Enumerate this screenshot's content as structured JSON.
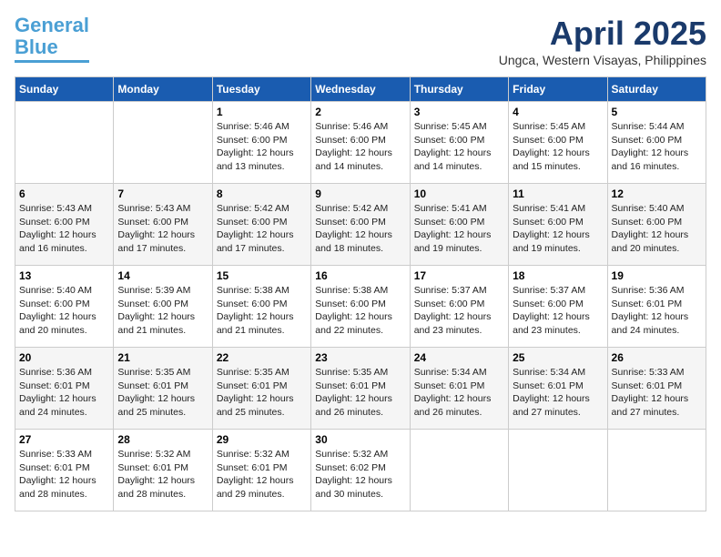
{
  "logo": {
    "line1": "General",
    "line2": "Blue"
  },
  "title": "April 2025",
  "location": "Ungca, Western Visayas, Philippines",
  "weekdays": [
    "Sunday",
    "Monday",
    "Tuesday",
    "Wednesday",
    "Thursday",
    "Friday",
    "Saturday"
  ],
  "weeks": [
    [
      {
        "day": "",
        "info": ""
      },
      {
        "day": "",
        "info": ""
      },
      {
        "day": "1",
        "info": "Sunrise: 5:46 AM\nSunset: 6:00 PM\nDaylight: 12 hours and 13 minutes."
      },
      {
        "day": "2",
        "info": "Sunrise: 5:46 AM\nSunset: 6:00 PM\nDaylight: 12 hours and 14 minutes."
      },
      {
        "day": "3",
        "info": "Sunrise: 5:45 AM\nSunset: 6:00 PM\nDaylight: 12 hours and 14 minutes."
      },
      {
        "day": "4",
        "info": "Sunrise: 5:45 AM\nSunset: 6:00 PM\nDaylight: 12 hours and 15 minutes."
      },
      {
        "day": "5",
        "info": "Sunrise: 5:44 AM\nSunset: 6:00 PM\nDaylight: 12 hours and 16 minutes."
      }
    ],
    [
      {
        "day": "6",
        "info": "Sunrise: 5:43 AM\nSunset: 6:00 PM\nDaylight: 12 hours and 16 minutes."
      },
      {
        "day": "7",
        "info": "Sunrise: 5:43 AM\nSunset: 6:00 PM\nDaylight: 12 hours and 17 minutes."
      },
      {
        "day": "8",
        "info": "Sunrise: 5:42 AM\nSunset: 6:00 PM\nDaylight: 12 hours and 17 minutes."
      },
      {
        "day": "9",
        "info": "Sunrise: 5:42 AM\nSunset: 6:00 PM\nDaylight: 12 hours and 18 minutes."
      },
      {
        "day": "10",
        "info": "Sunrise: 5:41 AM\nSunset: 6:00 PM\nDaylight: 12 hours and 19 minutes."
      },
      {
        "day": "11",
        "info": "Sunrise: 5:41 AM\nSunset: 6:00 PM\nDaylight: 12 hours and 19 minutes."
      },
      {
        "day": "12",
        "info": "Sunrise: 5:40 AM\nSunset: 6:00 PM\nDaylight: 12 hours and 20 minutes."
      }
    ],
    [
      {
        "day": "13",
        "info": "Sunrise: 5:40 AM\nSunset: 6:00 PM\nDaylight: 12 hours and 20 minutes."
      },
      {
        "day": "14",
        "info": "Sunrise: 5:39 AM\nSunset: 6:00 PM\nDaylight: 12 hours and 21 minutes."
      },
      {
        "day": "15",
        "info": "Sunrise: 5:38 AM\nSunset: 6:00 PM\nDaylight: 12 hours and 21 minutes."
      },
      {
        "day": "16",
        "info": "Sunrise: 5:38 AM\nSunset: 6:00 PM\nDaylight: 12 hours and 22 minutes."
      },
      {
        "day": "17",
        "info": "Sunrise: 5:37 AM\nSunset: 6:00 PM\nDaylight: 12 hours and 23 minutes."
      },
      {
        "day": "18",
        "info": "Sunrise: 5:37 AM\nSunset: 6:00 PM\nDaylight: 12 hours and 23 minutes."
      },
      {
        "day": "19",
        "info": "Sunrise: 5:36 AM\nSunset: 6:01 PM\nDaylight: 12 hours and 24 minutes."
      }
    ],
    [
      {
        "day": "20",
        "info": "Sunrise: 5:36 AM\nSunset: 6:01 PM\nDaylight: 12 hours and 24 minutes."
      },
      {
        "day": "21",
        "info": "Sunrise: 5:35 AM\nSunset: 6:01 PM\nDaylight: 12 hours and 25 minutes."
      },
      {
        "day": "22",
        "info": "Sunrise: 5:35 AM\nSunset: 6:01 PM\nDaylight: 12 hours and 25 minutes."
      },
      {
        "day": "23",
        "info": "Sunrise: 5:35 AM\nSunset: 6:01 PM\nDaylight: 12 hours and 26 minutes."
      },
      {
        "day": "24",
        "info": "Sunrise: 5:34 AM\nSunset: 6:01 PM\nDaylight: 12 hours and 26 minutes."
      },
      {
        "day": "25",
        "info": "Sunrise: 5:34 AM\nSunset: 6:01 PM\nDaylight: 12 hours and 27 minutes."
      },
      {
        "day": "26",
        "info": "Sunrise: 5:33 AM\nSunset: 6:01 PM\nDaylight: 12 hours and 27 minutes."
      }
    ],
    [
      {
        "day": "27",
        "info": "Sunrise: 5:33 AM\nSunset: 6:01 PM\nDaylight: 12 hours and 28 minutes."
      },
      {
        "day": "28",
        "info": "Sunrise: 5:32 AM\nSunset: 6:01 PM\nDaylight: 12 hours and 28 minutes."
      },
      {
        "day": "29",
        "info": "Sunrise: 5:32 AM\nSunset: 6:01 PM\nDaylight: 12 hours and 29 minutes."
      },
      {
        "day": "30",
        "info": "Sunrise: 5:32 AM\nSunset: 6:02 PM\nDaylight: 12 hours and 30 minutes."
      },
      {
        "day": "",
        "info": ""
      },
      {
        "day": "",
        "info": ""
      },
      {
        "day": "",
        "info": ""
      }
    ]
  ]
}
